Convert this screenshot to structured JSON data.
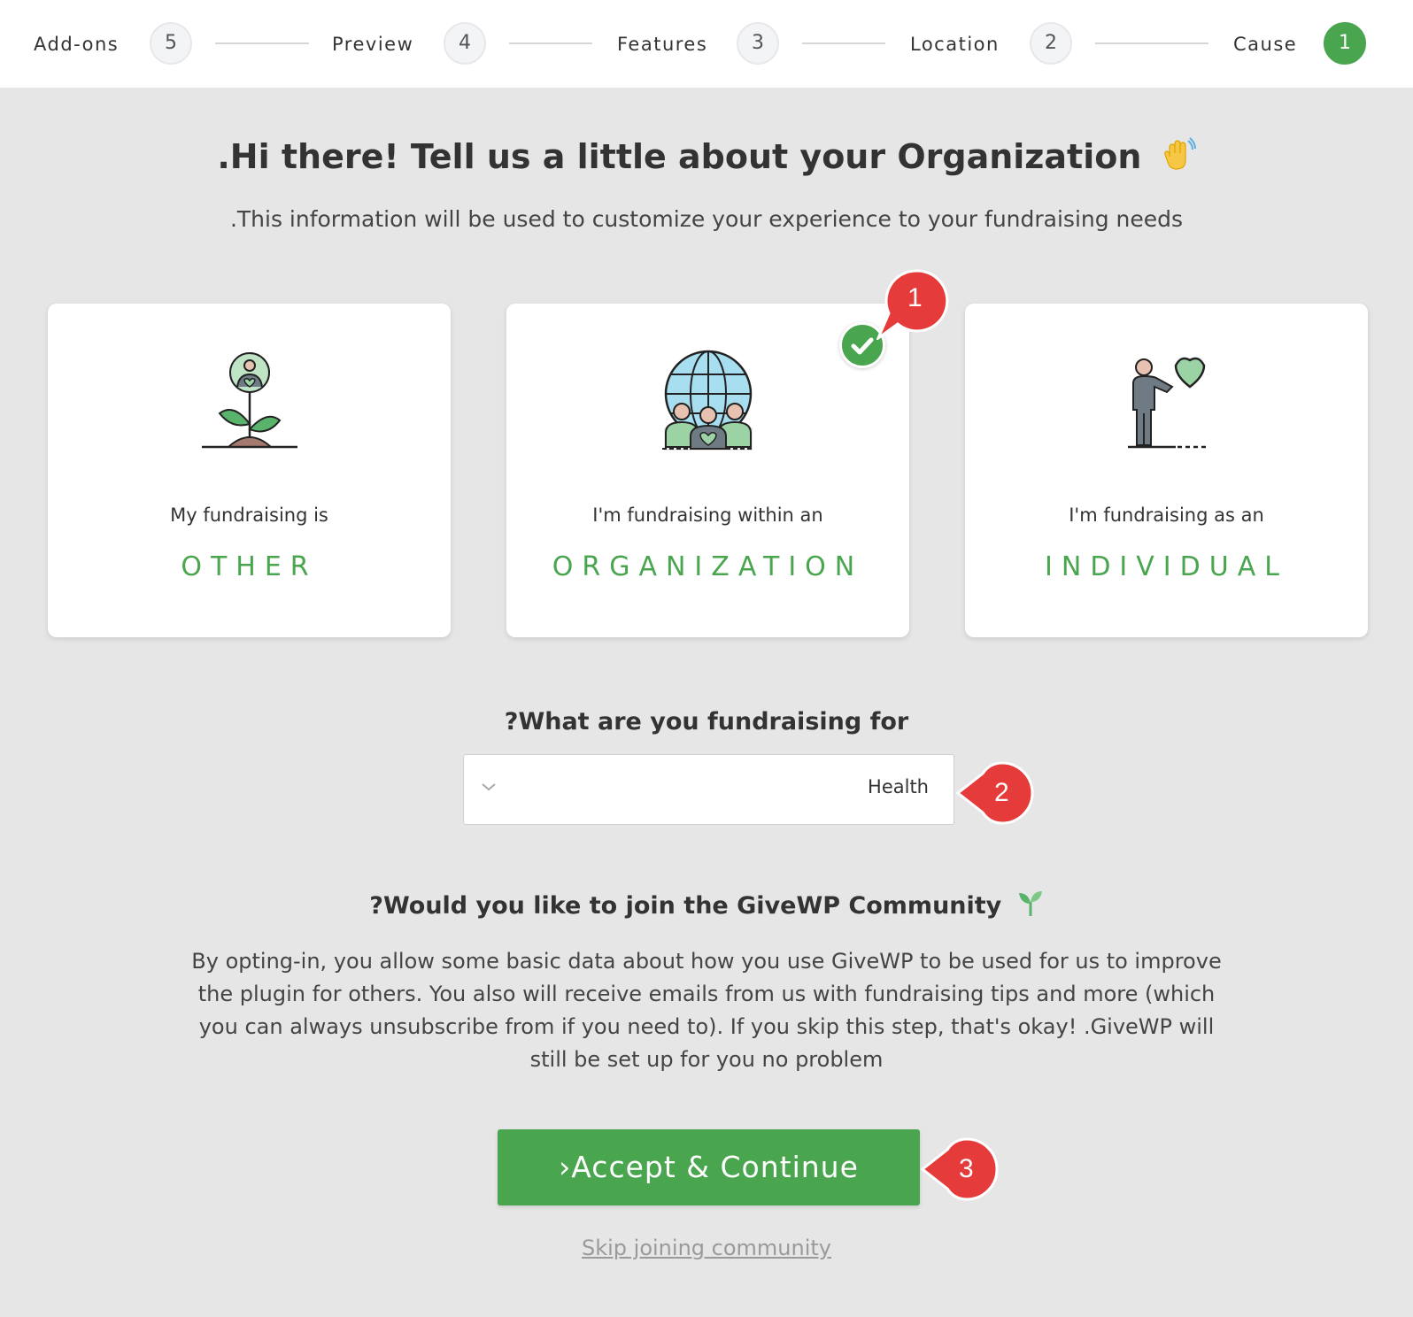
{
  "stepper": {
    "steps": [
      {
        "label": "Add-ons",
        "number": "5"
      },
      {
        "label": "Preview",
        "number": "4"
      },
      {
        "label": "Features",
        "number": "3"
      },
      {
        "label": "Location",
        "number": "2"
      },
      {
        "label": "Cause",
        "number": "1"
      }
    ],
    "active_step": "Cause"
  },
  "header": {
    "title": ".Hi there! Tell us a little about your Organization",
    "subtitle": ".This information will be used to customize your experience to your fundraising needs"
  },
  "cards": [
    {
      "text": "My fundraising is",
      "title": "OTHER",
      "icon": "flower-person-icon",
      "selected": false
    },
    {
      "text": "I'm fundraising within an",
      "title": "ORGANIZATION",
      "icon": "globe-people-icon",
      "selected": true
    },
    {
      "text": "I'm fundraising as an",
      "title": "INDIVIDUAL",
      "icon": "person-heart-icon",
      "selected": false
    }
  ],
  "cause": {
    "question": "?What are you fundraising for",
    "selected": "Health"
  },
  "community": {
    "question": "?Would you like to join the GiveWP Community",
    "description": "By opting-in, you allow some basic data about how you use GiveWP to be used for us to improve the plugin for others. You also will receive emails from us with fundraising tips and more (which you can always unsubscribe from if you need to). If you skip this step, that's okay! .GiveWP will still be set up for you no problem",
    "accept_label": "›Accept & Continue",
    "skip_label": "Skip joining community"
  },
  "callouts": [
    "1",
    "2",
    "3"
  ],
  "colors": {
    "accent": "#4aa54f",
    "callout": "#e53b3b",
    "background": "#e6e6e6"
  }
}
